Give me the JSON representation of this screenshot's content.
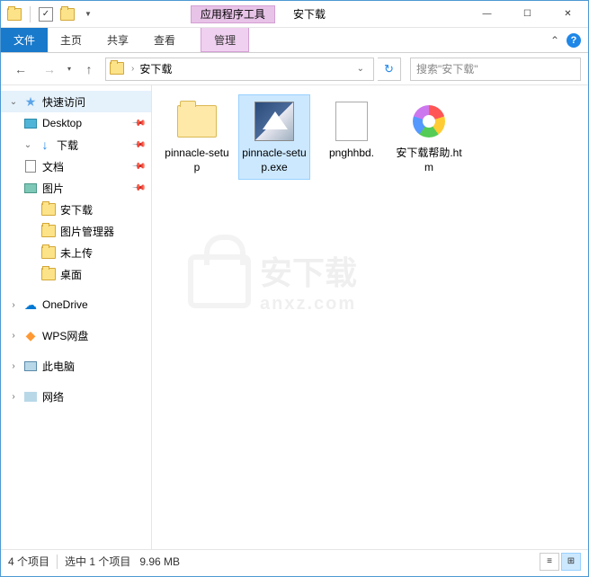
{
  "title": {
    "context_tab": "应用程序工具",
    "window_title": "安下载"
  },
  "ribbon": {
    "file": "文件",
    "home": "主页",
    "share": "共享",
    "view": "查看",
    "manage": "管理"
  },
  "address": {
    "current": "安下载"
  },
  "search": {
    "placeholder": "搜索\"安下载\""
  },
  "sidebar": {
    "quick_access": "快速访问",
    "desktop": "Desktop",
    "downloads": "下载",
    "documents": "文档",
    "pictures": "图片",
    "anxiazai": "安下载",
    "image_mgr": "图片管理器",
    "not_upload": "未上传",
    "desktop2": "桌面",
    "onedrive": "OneDrive",
    "wps": "WPS网盘",
    "this_pc": "此电脑",
    "network": "网络"
  },
  "files": [
    {
      "name": "pinnacle-setup"
    },
    {
      "name": "pinnacle-setup.exe"
    },
    {
      "name": "pnghhbd."
    },
    {
      "name": "安下载帮助.htm"
    }
  ],
  "watermark": {
    "main": "安下载",
    "sub": "anxz.com"
  },
  "status": {
    "count": "4 个项目",
    "selected": "选中 1 个项目",
    "size": "9.96 MB"
  }
}
